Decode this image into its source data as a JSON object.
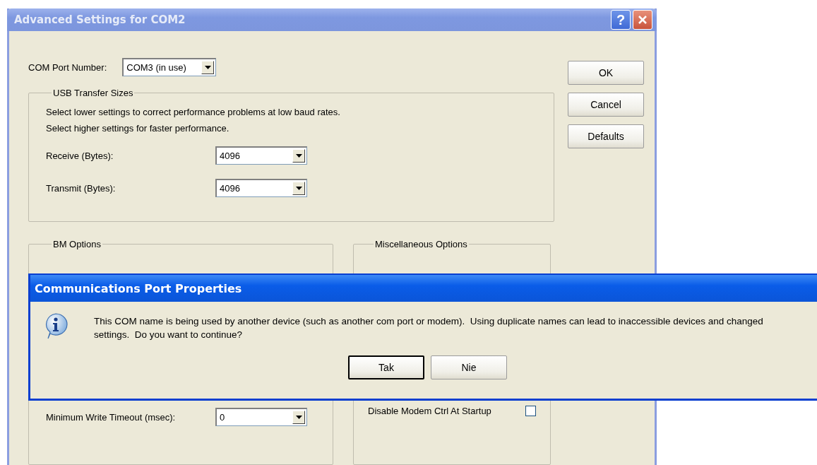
{
  "window": {
    "title": "Advanced Settings for COM2",
    "help_button": "?"
  },
  "com_port": {
    "label": "COM Port Number:",
    "value": "COM3 (in use)"
  },
  "usb_transfer": {
    "title": "USB Transfer Sizes",
    "notes": [
      "Select lower settings to correct performance problems at low baud rates.",
      "Select higher settings for faster performance."
    ],
    "fields": [
      {
        "label": "Receive (Bytes):",
        "value": "4096"
      },
      {
        "label": "Transmit (Bytes):",
        "value": "4096"
      }
    ]
  },
  "bm_options": {
    "title": "BM Options",
    "fields": [
      {
        "label": "Minimum Write Timeout (msec):",
        "value": "0"
      }
    ]
  },
  "misc_options": {
    "title": "Miscellaneous Options",
    "checkboxes": [
      {
        "label": "Disable Modem Ctrl At Startup",
        "checked": false
      }
    ]
  },
  "buttons": [
    "OK",
    "Cancel",
    "Defaults"
  ],
  "message_box": {
    "title": "Communications Port Properties",
    "message": "This COM name is being used by another device (such as another com port or modem).  Using duplicate names can lead to inaccessible devices and changed settings.  Do you want to continue?",
    "buttons": [
      {
        "label": "Tak",
        "default": true
      },
      {
        "label": "Nie",
        "default": false
      }
    ]
  }
}
